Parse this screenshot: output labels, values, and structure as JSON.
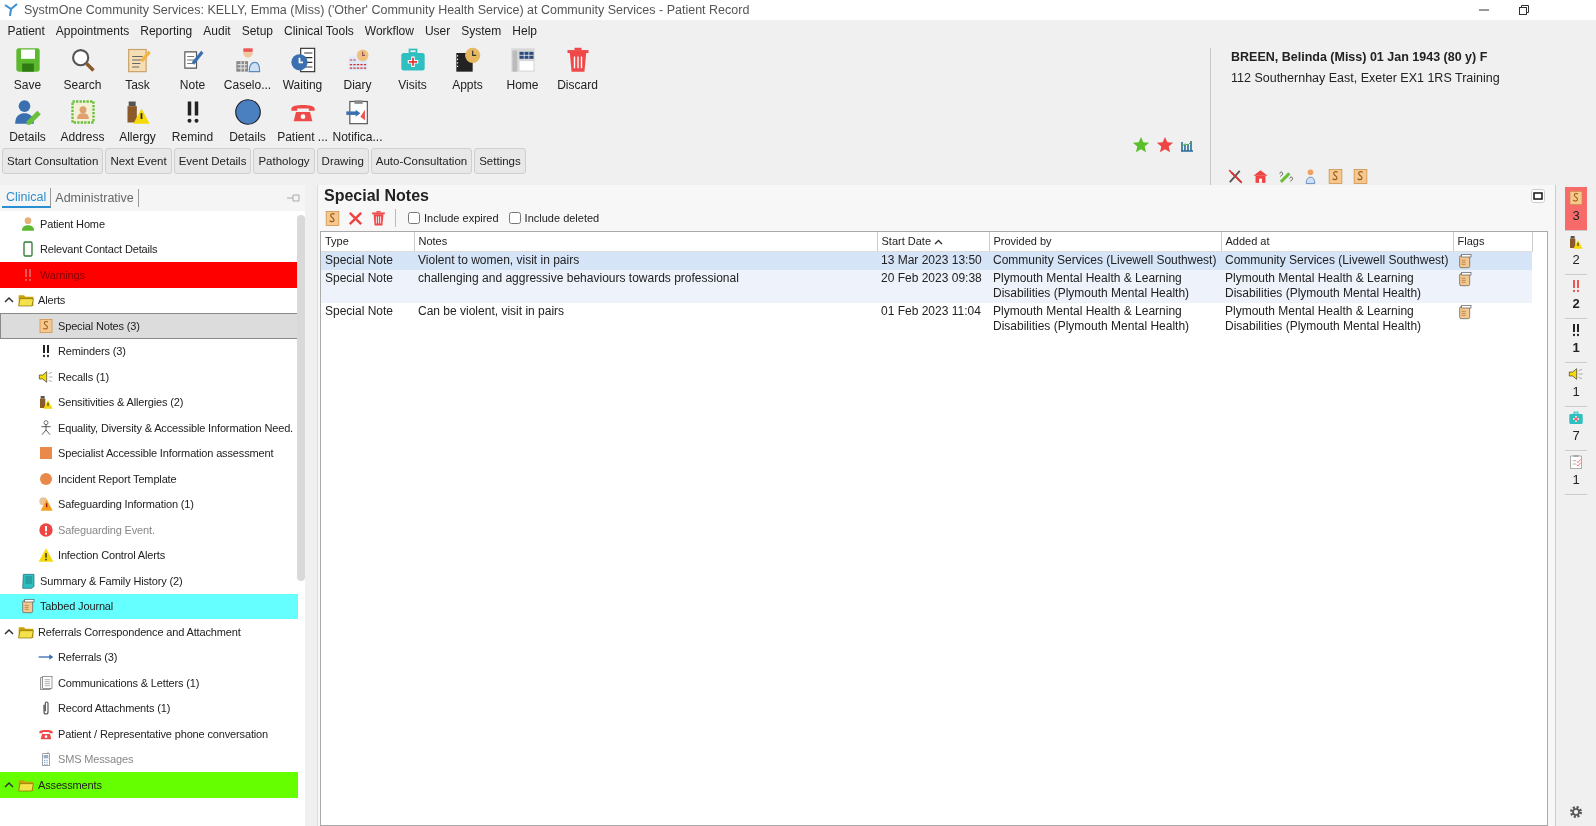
{
  "window": {
    "title": "SystmOne Community Services: KELLY, Emma (Miss) ('Other' Community Health Service) at Community Services - Patient Record"
  },
  "menu": [
    "Patient",
    "Appointments",
    "Reporting",
    "Audit",
    "Setup",
    "Clinical Tools",
    "Workflow",
    "User",
    "System",
    "Help"
  ],
  "toolbar_row_1": [
    "Save",
    "Search",
    "Task",
    "Note",
    "Caselo...",
    "Waiting",
    "Diary",
    "Visits",
    "Appts",
    "Home",
    "Discard"
  ],
  "toolbar_row_2": [
    "Details",
    "Address",
    "Allergy",
    "Remind",
    "Details",
    "Patient ...",
    "Notifica..."
  ],
  "function_buttons": [
    "Start Consultation",
    "Next Event",
    "Event Details",
    "Pathology",
    "Drawing",
    "Auto-Consultation",
    "Settings"
  ],
  "patient": {
    "name": "BREEN, Belinda (Miss) 01 Jan 1943 (80 y) F",
    "address": "112 Southernhay East, Exeter EX1 1RS  Training"
  },
  "sidebar": {
    "tabs": [
      {
        "label": "Clinical",
        "selected": true
      },
      {
        "label": "Administrative",
        "selected": false
      }
    ],
    "items": [
      {
        "label": "Patient Home",
        "selected": false
      },
      {
        "label": "Relevant Contact Details",
        "selected": false
      },
      {
        "label": "Warnings",
        "selected": false,
        "color": "#ff0000"
      },
      {
        "label": "Alerts",
        "selected": false,
        "expanded": true,
        "children": [
          {
            "label": "Special Notes (3)",
            "selected": true,
            "disabled": false
          },
          {
            "label": "Reminders (3)",
            "selected": false,
            "disabled": false
          },
          {
            "label": "Recalls (1)",
            "selected": false,
            "disabled": false
          },
          {
            "label": "Sensitivities & Allergies (2)",
            "selected": false,
            "disabled": false
          },
          {
            "label": "Equality, Diversity & Accessible Information Need.",
            "selected": false,
            "disabled": false
          },
          {
            "label": "Specialist Accessible Information assessment",
            "selected": false,
            "disabled": false
          },
          {
            "label": "Incident Report Template",
            "selected": false,
            "disabled": false
          },
          {
            "label": "Safeguarding Information (1)",
            "selected": false,
            "disabled": false
          },
          {
            "label": "Safeguarding Event.",
            "selected": false,
            "disabled": true
          },
          {
            "label": "Infection Control Alerts",
            "selected": false,
            "disabled": false
          }
        ]
      },
      {
        "label": "Summary & Family History (2)",
        "selected": false
      },
      {
        "label": "Tabbed Journal",
        "selected": false,
        "color": "#66ffff"
      },
      {
        "label": "Referrals Correspondence and Attachment",
        "selected": false,
        "expanded": true,
        "children": [
          {
            "label": "Referrals (3)",
            "selected": false,
            "disabled": false
          },
          {
            "label": "Communications & Letters (1)",
            "selected": false,
            "disabled": false
          },
          {
            "label": "Record Attachments (1)",
            "selected": false,
            "disabled": false
          },
          {
            "label": "Patient / Representative phone conversation",
            "selected": false,
            "disabled": false
          },
          {
            "label": "SMS Messages",
            "selected": false,
            "disabled": true
          }
        ]
      },
      {
        "label": "Assessments",
        "selected": false,
        "expanded": true,
        "color": "#66ff00"
      }
    ]
  },
  "panel": {
    "title": "Special Notes",
    "checkboxes": [
      {
        "label": "Include expired",
        "checked": false
      },
      {
        "label": "Include deleted",
        "checked": false
      }
    ],
    "table": {
      "columns": [
        {
          "label": "Type",
          "sorted": false
        },
        {
          "label": "Notes",
          "sorted": false
        },
        {
          "label": "Start Date",
          "sorted": true
        },
        {
          "label": "Provided by",
          "sorted": false
        },
        {
          "label": "Added at",
          "sorted": false
        },
        {
          "label": "Flags",
          "sorted": false
        }
      ],
      "rows": [
        {
          "selected": true,
          "cells": [
            "Special Note",
            "Violent to women, visit in pairs",
            "13 Mar 2023 13:50",
            "Community Services (Livewell Southwest)",
            "Community Services (Livewell Southwest)"
          ]
        },
        {
          "selected": false,
          "cells": [
            "Special Note",
            "challenging and aggressive behaviours towards professional",
            "20 Feb 2023 09:38",
            "Plymouth Mental Health & Learning Disabilities (Plymouth Mental Health)",
            "Plymouth Mental Health & Learning Disabilities (Plymouth Mental Health)"
          ]
        },
        {
          "selected": false,
          "cells": [
            "Special Note",
            "Can be violent, visit in pairs",
            "01 Feb 2023 11:04",
            "Plymouth Mental Health & Learning Disabilities (Plymouth Mental Health)",
            "Plymouth Mental Health & Learning Disabilities (Plymouth Mental Health)"
          ]
        }
      ]
    }
  },
  "alert_strip": [
    {
      "count": "3",
      "highlighted": true,
      "bold": false
    },
    {
      "count": "2",
      "highlighted": false,
      "bold": false
    },
    {
      "count": "2",
      "highlighted": false,
      "bold": true
    },
    {
      "count": "1",
      "highlighted": false,
      "bold": true
    },
    {
      "count": "1",
      "highlighted": false,
      "bold": false
    },
    {
      "count": "7",
      "highlighted": false,
      "bold": false
    },
    {
      "count": "1",
      "highlighted": false,
      "bold": false
    }
  ]
}
